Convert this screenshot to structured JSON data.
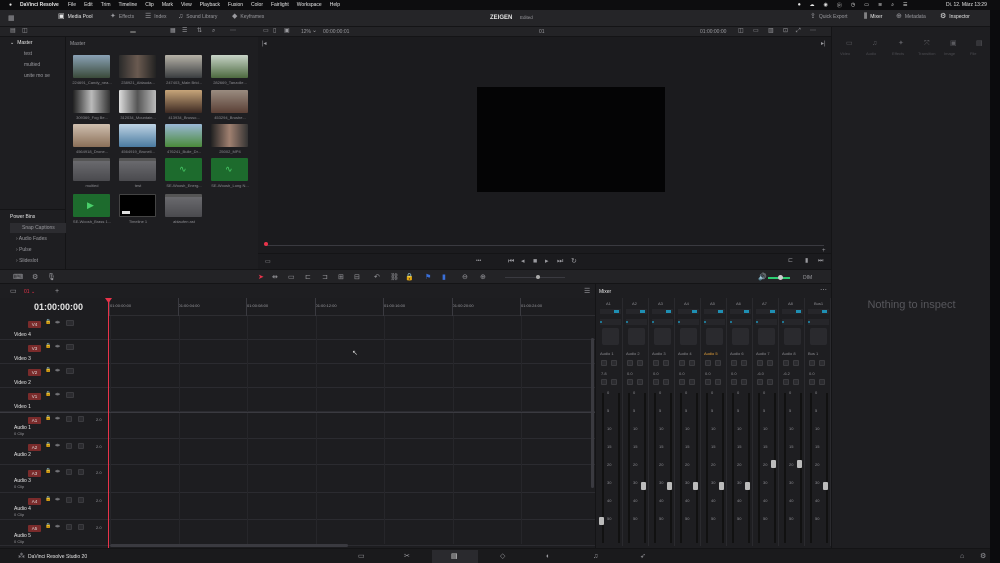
{
  "menubar": {
    "apple": "",
    "app": "DaVinci Resolve",
    "items": [
      "File",
      "Edit",
      "Trim",
      "Timeline",
      "Clip",
      "Mark",
      "View",
      "Playback",
      "Fusion",
      "Color",
      "Fairlight",
      "Workspace",
      "Help"
    ],
    "datetime": "Di. 12. März  13:29"
  },
  "toolbar": {
    "media_pool": "Media Pool",
    "effects": "Effects",
    "index": "Index",
    "sound_library": "Sound Library",
    "keyframes": "Keyframes",
    "project": "ZEIGEN",
    "edited": "Edited",
    "quick_export": "Quick Export",
    "mixer": "Mixer",
    "metadata": "Metadata",
    "inspector": "Inspector"
  },
  "viewer": {
    "zoom": "12%",
    "timecode": "00:00:00:01",
    "clip_number": "01",
    "tc_right": "01:00:00:00"
  },
  "bins": {
    "master": "Master",
    "items": [
      "test",
      "multied",
      "unite mo se"
    ],
    "smart_bins": "Power Bins",
    "smart_items": [
      "Snap Captions",
      "Audio Fades",
      "Pulse",
      "Slideslot"
    ]
  },
  "pool": {
    "title": "Master",
    "clips": [
      "224691_Candy_nea...",
      "238921_Ablauda...",
      "247403_Main Brid...",
      "282669_Tanzolle...",
      "309369_Fog Be...",
      "312034_Mountain...",
      "413934_Brusso...",
      "453294_Brushe...",
      "4564918_Drone...",
      "4564919_Brunell...",
      "476241_Bulle_Dr...",
      "25002_MP4",
      "multied",
      "test",
      "SE-Woosh_Energ...",
      "SE-Woosh_Long N...",
      "SE-Woosh_Brass 1...",
      "Timeline 1",
      "ablaufen ast"
    ]
  },
  "timeline": {
    "timecode": "01:00:00:00",
    "ruler": [
      "01:00:00:00",
      "01:00:04:00",
      "01:00:08:00",
      "01:00:12:00",
      "01:00:16:00",
      "01:00:20:00",
      "01:00:24:00"
    ],
    "tracks": [
      {
        "id": "V4",
        "name": "Video 4"
      },
      {
        "id": "V3",
        "name": "Video 3"
      },
      {
        "id": "V2",
        "name": "Video 2"
      },
      {
        "id": "V1",
        "name": "Video 1"
      },
      {
        "id": "A1",
        "name": "Audio 1",
        "sub": "0 Clip"
      },
      {
        "id": "A2",
        "name": "Audio 2",
        "sub": ""
      },
      {
        "id": "A3",
        "name": "Audio 3",
        "sub": "0 Clip"
      },
      {
        "id": "A4",
        "name": "Audio 4",
        "sub": "0 Clip"
      },
      {
        "id": "A5",
        "name": "Audio 5",
        "sub": "0 Clip"
      }
    ],
    "track_level": "2.0"
  },
  "mixer": {
    "title": "Mixer",
    "buses": [
      "A1",
      "A2",
      "A3",
      "A4",
      "A5",
      "A6",
      "A7",
      "A8",
      "Bus1"
    ],
    "labels": [
      "Audio 1",
      "Audio 2",
      "Audio 3",
      "Audio 4",
      "Audio 5",
      "Audio 6",
      "Audio 7",
      "Audio 8",
      "Bus 1"
    ],
    "values": [
      "7.8",
      "0.0",
      "0.0",
      "0.0",
      "0.0",
      "0.0",
      "-6.0",
      "-6.2",
      "0.0"
    ],
    "scale": [
      "0",
      "5",
      "10",
      "15",
      "20",
      "30",
      "40",
      "50"
    ]
  },
  "inspector": {
    "tabs": [
      "Video",
      "Audio",
      "Effects",
      "Transition",
      "Image",
      "File"
    ],
    "empty": "Nothing to inspect"
  },
  "pages": {
    "app_name": "DaVinci Resolve Studio 20"
  },
  "colors": {
    "accent": "#e8334a",
    "bg": "#1e1e21"
  }
}
